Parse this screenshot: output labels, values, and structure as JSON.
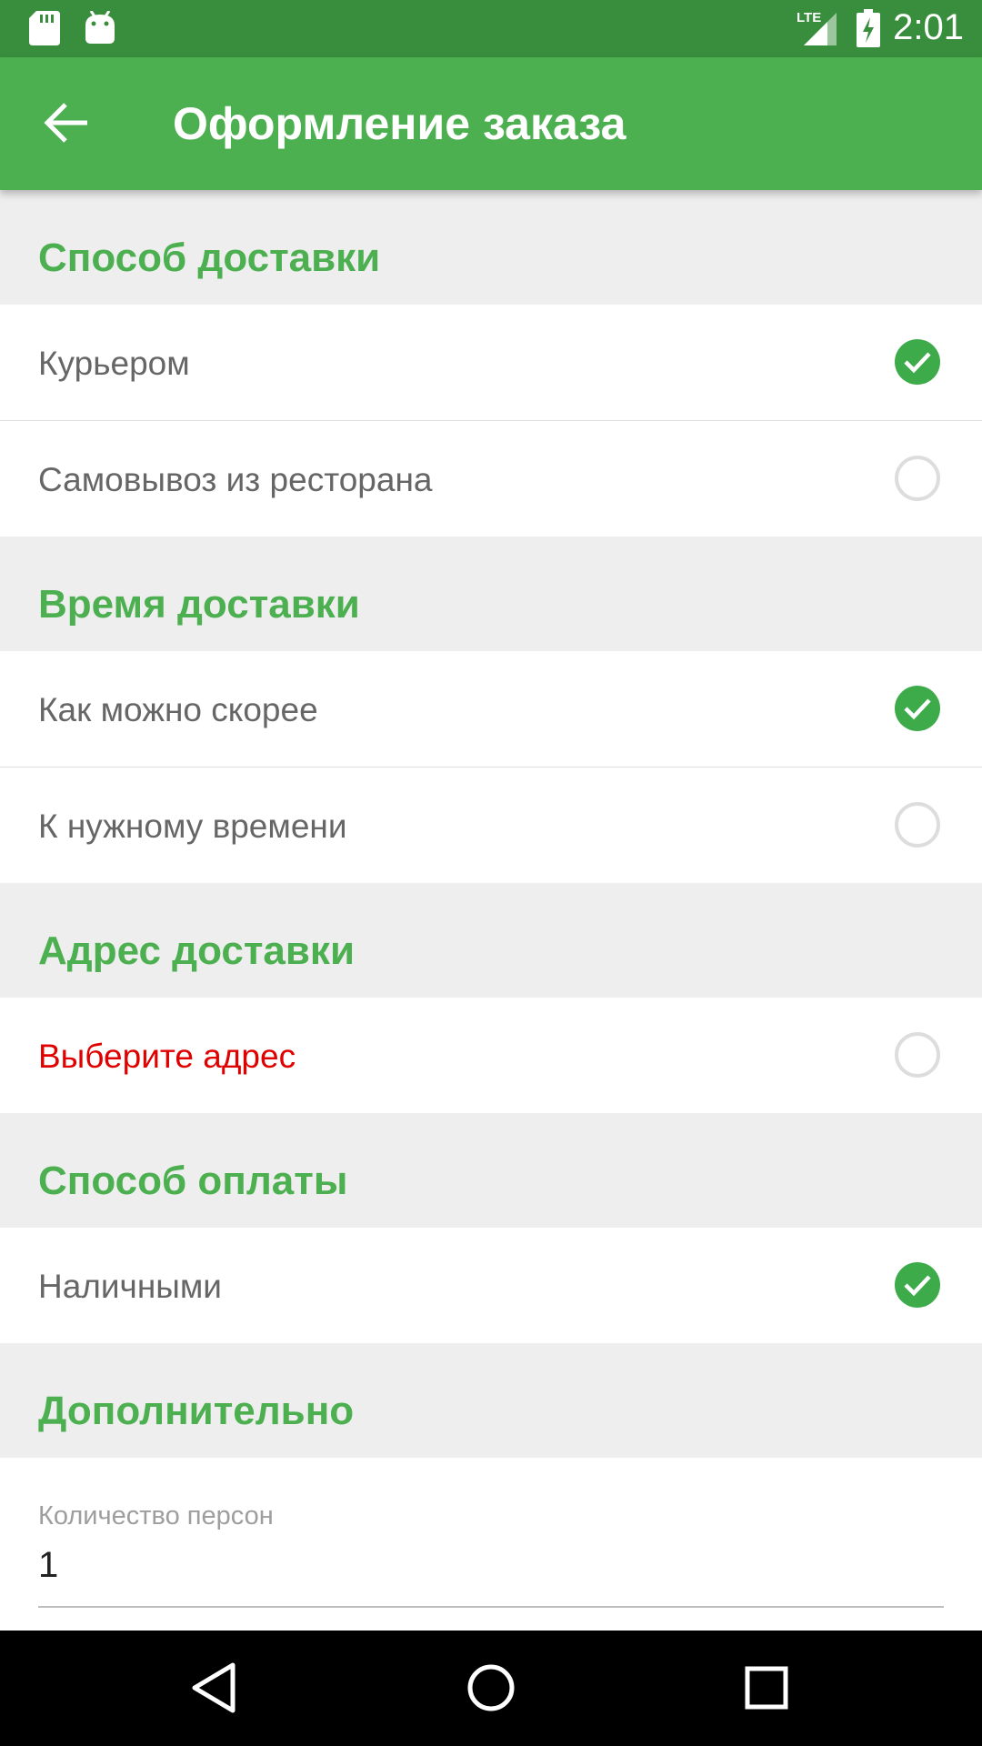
{
  "status_bar": {
    "time": "2:01",
    "network": "LTE",
    "icons": [
      "sd-card-icon",
      "android-icon",
      "signal-icon",
      "battery-charging-icon"
    ]
  },
  "app_bar": {
    "title": "Оформление заказа",
    "back_icon": "arrow-back-icon"
  },
  "sections": {
    "delivery_method": {
      "header": "Способ доставки",
      "options": [
        {
          "label": "Курьером",
          "checked": true
        },
        {
          "label": "Самовывоз из ресторана",
          "checked": false
        }
      ]
    },
    "delivery_time": {
      "header": "Время доставки",
      "options": [
        {
          "label": "Как можно скорее",
          "checked": true
        },
        {
          "label": "К нужному времени",
          "checked": false
        }
      ]
    },
    "delivery_address": {
      "header": "Адрес доставки",
      "options": [
        {
          "label": "Выберите адрес",
          "checked": false,
          "error": true
        }
      ]
    },
    "payment_method": {
      "header": "Способ оплаты",
      "options": [
        {
          "label": "Наличными",
          "checked": true
        }
      ]
    },
    "additional": {
      "header": "Дополнительно",
      "persons_label": "Количество персон",
      "persons_value": "1"
    }
  },
  "colors": {
    "status_bar": "#388e3c",
    "app_bar": "#4caf50",
    "accent": "#4caf50",
    "error": "#e00000"
  },
  "nav_bar": {
    "icons": [
      "back-triangle-icon",
      "home-circle-icon",
      "recents-square-icon"
    ]
  }
}
